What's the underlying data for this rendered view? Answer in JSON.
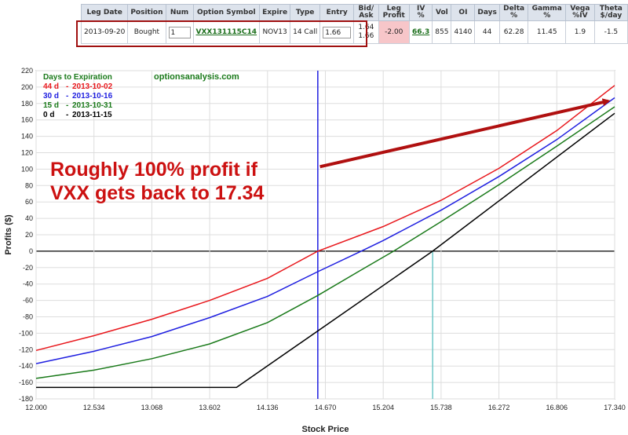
{
  "leg_table": {
    "headers": [
      "Leg Date",
      "Position",
      "Num",
      "Option Symbol",
      "Expire",
      "Type",
      "Entry",
      "Bid/ Ask",
      "Leg Profit",
      "IV %",
      "Vol",
      "OI",
      "Days",
      "Delta %",
      "Gamma %",
      "Vega %IV",
      "Theta $/day"
    ],
    "row": {
      "leg_date": "2013-09-20",
      "position": "Bought",
      "num": "1",
      "symbol": "VXX131115C14",
      "expire": "NOV13",
      "type": "14 Call",
      "entry": "1.66",
      "bid": "1.64",
      "ask": "1.66",
      "leg_profit": "-2.00",
      "iv": "66.3",
      "vol": "855",
      "oi": "4140",
      "days": "44",
      "delta": "62.28",
      "gamma": "11.45",
      "vega": "1.9",
      "theta": "-1.5"
    }
  },
  "chart_data": {
    "type": "line",
    "ylabel": "Profits ($)",
    "xlabel": "Stock Price",
    "watermark": "optionsanalysis.com",
    "legend_title": "Days to Expiration",
    "legend_placement": "top-left",
    "xlim": [
      12.0,
      17.34
    ],
    "ylim": [
      -180,
      220
    ],
    "x_ticks": [
      "12.000",
      "12.534",
      "13.068",
      "13.602",
      "14.136",
      "14.670",
      "15.204",
      "15.738",
      "16.272",
      "16.806",
      "17.340"
    ],
    "y_ticks": [
      -180,
      -160,
      -140,
      -120,
      -100,
      -80,
      -60,
      -40,
      -20,
      0,
      20,
      40,
      60,
      80,
      100,
      120,
      140,
      160,
      180,
      200,
      220
    ],
    "grid": true,
    "current_price_line": 14.6,
    "breakeven_line": 15.66,
    "series": [
      {
        "name": "44 d",
        "date": "2013-10-02",
        "color": "#e8171c",
        "points": [
          [
            12.0,
            -121
          ],
          [
            12.534,
            -103
          ],
          [
            13.068,
            -83
          ],
          [
            13.602,
            -60
          ],
          [
            14.136,
            -33
          ],
          [
            14.6,
            0
          ],
          [
            15.204,
            30
          ],
          [
            15.738,
            62
          ],
          [
            16.272,
            101
          ],
          [
            16.806,
            147
          ],
          [
            17.34,
            202
          ]
        ]
      },
      {
        "name": "30 d",
        "date": "2013-10-16",
        "color": "#1f1fe0",
        "points": [
          [
            12.0,
            -137
          ],
          [
            12.534,
            -122
          ],
          [
            13.068,
            -104
          ],
          [
            13.602,
            -81
          ],
          [
            14.136,
            -55
          ],
          [
            14.6,
            -25
          ],
          [
            15.0,
            0
          ],
          [
            15.204,
            13
          ],
          [
            15.738,
            50
          ],
          [
            16.272,
            91
          ],
          [
            16.806,
            136
          ],
          [
            17.34,
            187
          ]
        ]
      },
      {
        "name": "15 d",
        "date": "2013-10-31",
        "color": "#1a7a1a",
        "points": [
          [
            12.0,
            -155
          ],
          [
            12.534,
            -145
          ],
          [
            13.068,
            -131
          ],
          [
            13.602,
            -113
          ],
          [
            14.136,
            -87
          ],
          [
            14.6,
            -54
          ],
          [
            15.0,
            -23
          ],
          [
            15.3,
            0
          ],
          [
            15.738,
            36
          ],
          [
            16.272,
            81
          ],
          [
            16.806,
            128
          ],
          [
            17.34,
            176
          ]
        ]
      },
      {
        "name": "0 d",
        "date": "2013-11-15",
        "color": "#000000",
        "points": [
          [
            12.0,
            -166
          ],
          [
            13.85,
            -166
          ],
          [
            15.66,
            0
          ],
          [
            17.34,
            168
          ]
        ]
      }
    ],
    "annotation": {
      "text_lines": [
        "Roughly 100% profit if",
        "VXX gets back to 17.34"
      ],
      "color": "#cc1111",
      "arrow_from": [
        14.62,
        103
      ],
      "arrow_to": [
        17.28,
        183
      ]
    }
  }
}
